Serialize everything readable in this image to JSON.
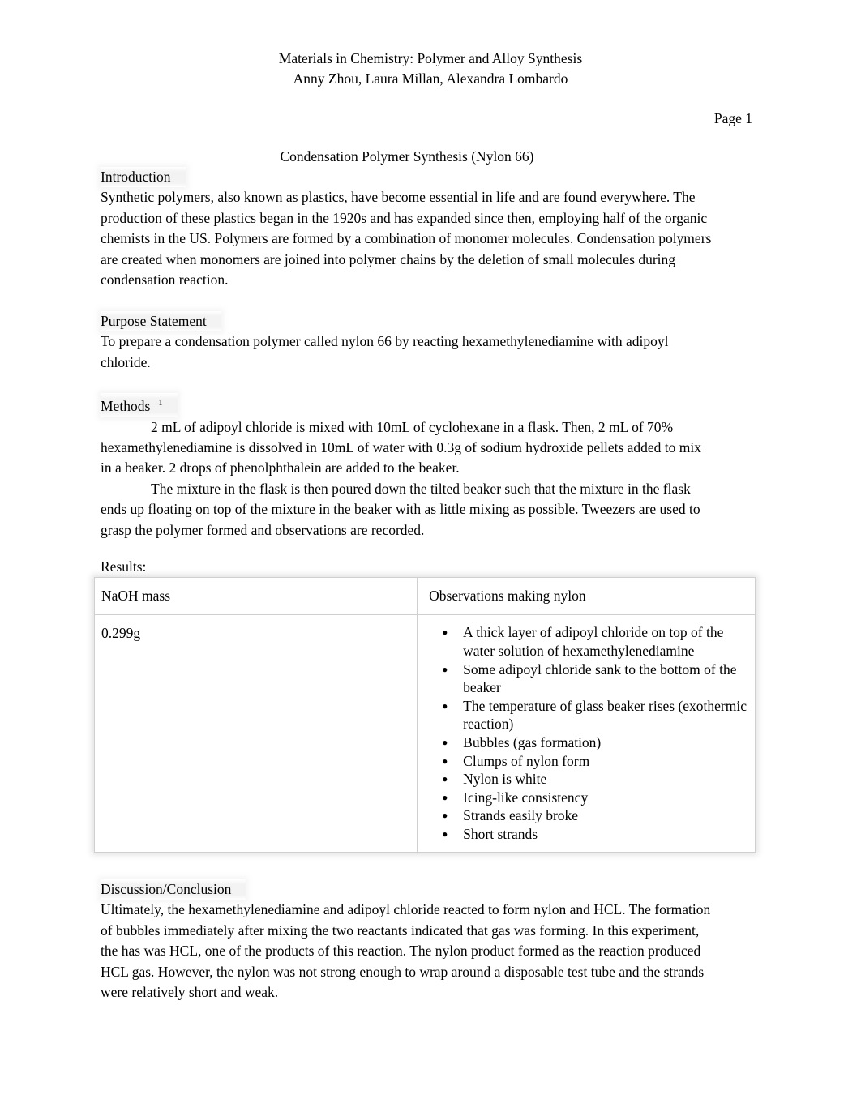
{
  "document": {
    "header": {
      "title_line": "Materials in Chemistry: Polymer and Alloy Synthesis",
      "authors_line": "Anny Zhou, Laura Millan, Alexandra Lombardo"
    },
    "page_number": "Page 1",
    "section_title": "Condensation Polymer Synthesis (Nylon 66)",
    "sections": {
      "introduction": {
        "heading": "Introduction",
        "body": "Synthetic polymers, also known as plastics, have become essential in life and are found everywhere. The production of these plastics began in the 1920s and has expanded since then, employing half of the organic chemists in the US. Polymers are formed by a combination of monomer molecules. Condensation polymers are created when monomers are joined into polymer chains by the deletion of small molecules during condensation reaction."
      },
      "purpose": {
        "heading": "Purpose Statement",
        "body": "To prepare a condensation polymer called nylon 66 by reacting hexamethylenediamine with adipoyl chloride."
      },
      "methods": {
        "heading": "Methods",
        "footnote_marker": "1",
        "paragraph_1": "2 mL of adipoyl chloride is mixed with 10mL of cyclohexane in a flask. Then, 2 mL of 70% hexamethylenediamine is dissolved in 10mL of water with 0.3g of sodium hydroxide pellets added to mix in a beaker. 2 drops of phenolphthalein are added to the beaker.",
        "paragraph_2": "The mixture in the flask is then poured down the tilted beaker such that the mixture in the flask ends up floating on top of the mixture in the beaker with as little mixing as possible. Tweezers are used to grasp the polymer formed and observations are recorded."
      },
      "results": {
        "label": "Results:",
        "table": {
          "columns": [
            "NaOH mass",
            "Observations making nylon"
          ],
          "naoh_mass_value": "0.299g",
          "observations": [
            "A thick layer of adipoyl chloride on top of the water solution of hexamethylenediamine",
            "Some adipoyl chloride sank to the bottom of the beaker",
            "The temperature of glass beaker rises (exothermic reaction)",
            "Bubbles (gas formation)",
            "Clumps of nylon form",
            "Nylon is white",
            "Icing-like consistency",
            "Strands easily broke",
            "Short strands"
          ]
        }
      },
      "discussion": {
        "heading": "Discussion/Conclusion",
        "body": "Ultimately, the hexamethylenediamine and adipoyl chloride reacted to form nylon and HCL. The formation of bubbles immediately after mixing the two reactants indicated that gas was forming. In this experiment, the has was HCL, one of the products of this reaction. The nylon product formed as the reaction produced HCL gas. However, the nylon was not strong enough to wrap around a disposable test tube and the strands were relatively short and weak."
      }
    }
  },
  "colors": {
    "page_background": "#ffffff",
    "text": "#000000",
    "table_border": "#cfcfcf",
    "heading_halo": "#f2f2f2"
  }
}
